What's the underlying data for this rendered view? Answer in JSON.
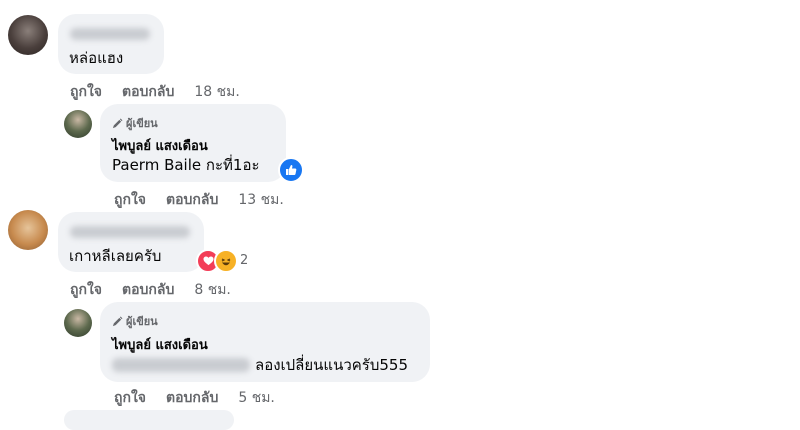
{
  "c1": {
    "text": "หล่อแฮง",
    "time": "18 ชม."
  },
  "r1": {
    "badge": "ผู้เขียน",
    "name": "ไพบูลย์ แสงเดือน",
    "text": "Paerm Baile กะที่1อะ",
    "time": "13 ชม."
  },
  "c2": {
    "text": "เกาหลีเลยครับ",
    "reaction_count": "2",
    "time": "8 ชม."
  },
  "r2": {
    "badge": "ผู้เขียน",
    "name": "ไพบูลย์ แสงเดือน",
    "text": "ลองเปลี่ยนแนวครับ555",
    "time": "5 ชม."
  },
  "actions": {
    "like": "ถูกใจ",
    "reply": "ตอบกลับ"
  },
  "colors": {
    "bubble": "#f0f2f5",
    "meta": "#65676b",
    "like_blue": "#1877f2",
    "love_red": "#f33e58",
    "haha_yellow": "#f7b125"
  },
  "icons": [
    "pen-icon",
    "like-reaction-icon",
    "love-reaction-icon",
    "haha-reaction-icon"
  ]
}
